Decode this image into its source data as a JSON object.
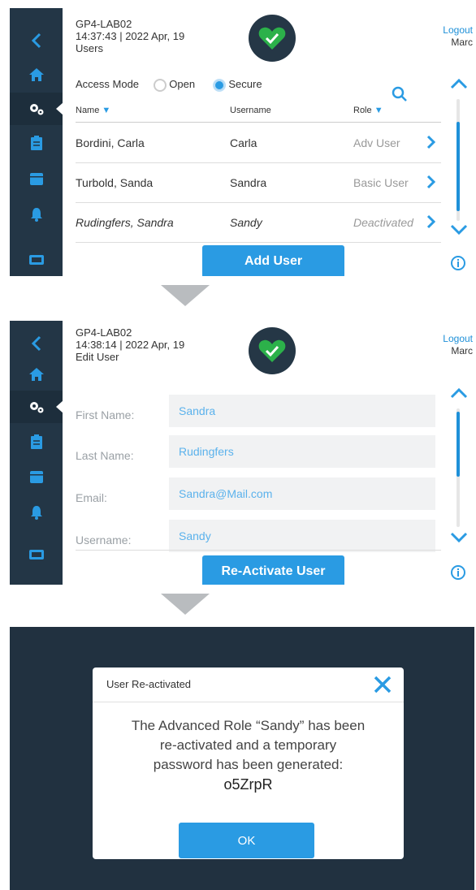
{
  "colors": {
    "accent": "#2a9be3",
    "sidebar": "#233646",
    "heart": "#2cb14a",
    "overlay": "#213140"
  },
  "sidebar_icons": [
    "back-chevron-icon",
    "home-icon",
    "settings-gears-icon",
    "clipboard-icon",
    "calendar-icon",
    "bell-icon",
    "monitor-icon"
  ],
  "screen1": {
    "device": "GP4-LAB02",
    "datetime": "14:37:43 | 2022 Apr, 19",
    "page": "Users",
    "logout": "Logout",
    "user": "Marc",
    "access_mode_label": "Access Mode",
    "mode_open": "Open",
    "mode_secure": "Secure",
    "columns": {
      "name": "Name",
      "username": "Username",
      "role": "Role"
    },
    "rows": [
      {
        "name": "Bordini, Carla",
        "username": "Carla",
        "role": "Adv User"
      },
      {
        "name": "Turbold, Sanda",
        "username": "Sandra",
        "role": "Basic User"
      },
      {
        "name": "Rudingfers, Sandra",
        "username": "Sandy",
        "role": "Deactivated"
      }
    ],
    "add_button": "Add User"
  },
  "screen2": {
    "device": "GP4-LAB02",
    "datetime": "14:38:14 | 2022 Apr, 19",
    "page": "Edit User",
    "logout": "Logout",
    "user": "Marc",
    "fields": [
      {
        "label": "First Name:",
        "value": "Sandra"
      },
      {
        "label": "Last Name:",
        "value": "Rudingfers"
      },
      {
        "label": "Email:",
        "value": "Sandra@Mail.com"
      },
      {
        "label": "Username:",
        "value": "Sandy"
      }
    ],
    "reactivate_button": "Re-Activate User"
  },
  "dialog": {
    "title": "User Re-activated",
    "message_line1": "The Advanced Role “Sandy” has been",
    "message_line2": "re-activated and a temporary",
    "message_line3": "password has been generated:",
    "password": "o5ZrpR",
    "ok": "OK"
  }
}
